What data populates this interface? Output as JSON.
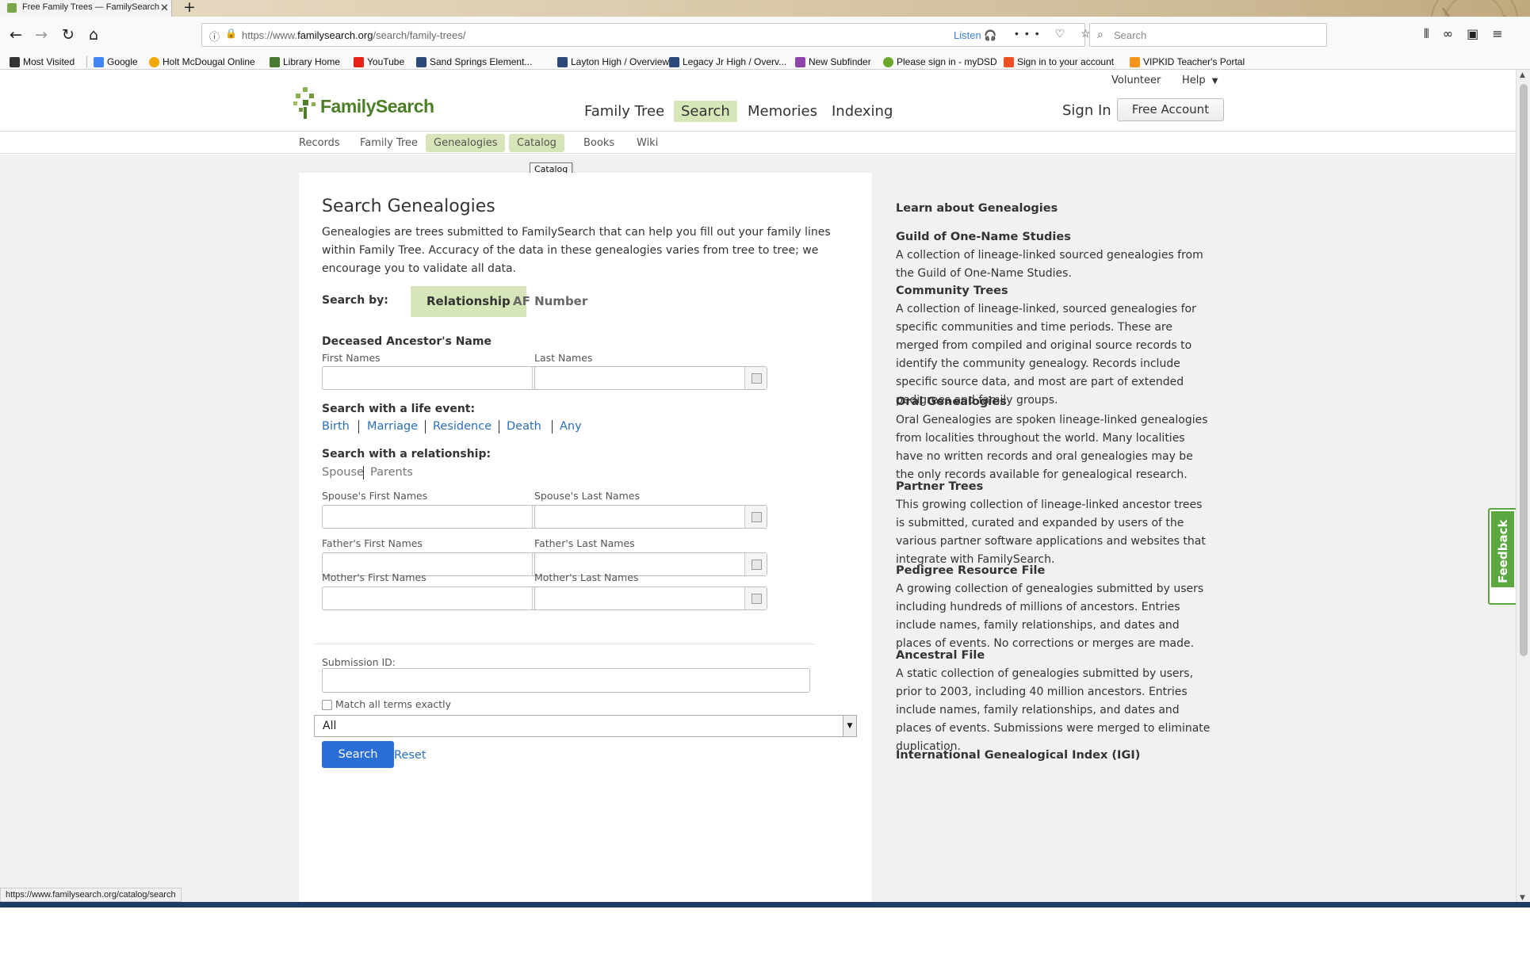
{
  "browser": {
    "tab_title": "Free Family Trees — FamilySearch",
    "url_path_pre": "https://www.",
    "url_domain": "familysearch.org",
    "url_path": "/search/family-trees/",
    "listen_label": "Listen",
    "search_placeholder": "Search",
    "bookmarks": [
      {
        "label": "Most Visited",
        "icon": "gear-icon",
        "color": "#333333"
      },
      {
        "label": "Google",
        "icon": "google-icon",
        "color": "#4285f4"
      },
      {
        "label": "Holt McDougal Online",
        "icon": "holt-icon",
        "color": "#f0a800"
      },
      {
        "label": "Library Home",
        "icon": "library-icon",
        "color": "#4a7a32"
      },
      {
        "label": "YouTube",
        "icon": "youtube-icon",
        "color": "#e62117"
      },
      {
        "label": "Sand Springs Element...",
        "icon": "school-icon",
        "color": "#2b4a7a"
      },
      {
        "label": "Layton High / Overview",
        "icon": "school-icon",
        "color": "#2b4a7a"
      },
      {
        "label": "Legacy Jr High / Overv...",
        "icon": "school-icon",
        "color": "#2b4a7a"
      },
      {
        "label": "New Subfinder",
        "icon": "subfinder-icon",
        "color": "#8e44ad"
      },
      {
        "label": "Please sign in - myDSD",
        "icon": "leaf-icon",
        "color": "#6aa82c"
      },
      {
        "label": "Sign in to your account",
        "icon": "microsoft-icon",
        "color": "#f25022"
      },
      {
        "label": "VIPKID Teacher's Portal",
        "icon": "vipkid-icon",
        "color": "#f7941d"
      }
    ],
    "status_url": "https://www.familysearch.org/catalog/search"
  },
  "header": {
    "logo_text": "FamilySearch",
    "utility": {
      "volunteer": "Volunteer",
      "help": "Help"
    },
    "main_nav": [
      {
        "label": "Family Tree",
        "active": false
      },
      {
        "label": "Search",
        "active": true
      },
      {
        "label": "Memories",
        "active": false
      },
      {
        "label": "Indexing",
        "active": false
      }
    ],
    "sign_in": "Sign In",
    "free_account": "Free Account",
    "sub_nav": [
      {
        "label": "Records",
        "active": false
      },
      {
        "label": "Family Tree",
        "active": false
      },
      {
        "label": "Genealogies",
        "active": true
      },
      {
        "label": "Catalog",
        "active": true
      },
      {
        "label": "Books",
        "active": false
      },
      {
        "label": "Wiki",
        "active": false
      }
    ],
    "tooltip": "Catalog"
  },
  "search": {
    "title": "Search Genealogies",
    "intro": "Genealogies are trees submitted to FamilySearch that can help you fill out your family lines within Family Tree. Accuracy of the data in these genealogies varies from tree to tree; we encourage you to validate all data.",
    "search_by_label": "Search by:",
    "search_by_options": [
      "Relationship",
      "AF Number"
    ],
    "ancestor_heading": "Deceased Ancestor's Name",
    "first_names": "First Names",
    "last_names": "Last Names",
    "life_event_heading": "Search with a life event:",
    "life_events": [
      "Birth",
      "Marriage",
      "Residence",
      "Death",
      "Any"
    ],
    "relationship_heading": "Search with a relationship:",
    "relationships": [
      "Spouse",
      "Parents"
    ],
    "spouse_first": "Spouse's First Names",
    "spouse_last": "Spouse's Last Names",
    "father_first": "Father's First Names",
    "father_last": "Father's Last Names",
    "mother_first": "Mother's First Names",
    "mother_last": "Mother's Last Names",
    "submission_id": "Submission ID:",
    "match_exact": "Match all terms exactly",
    "collection_selected": "All",
    "search_button": "Search",
    "reset": "Reset"
  },
  "sidebar": {
    "heading": "Learn about Genealogies",
    "sections": [
      {
        "title": "Guild of One-Name Studies",
        "body": "A collection of lineage-linked sourced genealogies from the Guild of One-Name Studies."
      },
      {
        "title": "Community Trees",
        "body": "A collection of lineage-linked, sourced genealogies for specific communities and time periods. These are merged from compiled and original source records to identify the community genealogy. Records include specific source data, and most are part of extended pedigrees and family groups."
      },
      {
        "title": "Oral Genealogies",
        "body": "Oral Genealogies are spoken lineage-linked genealogies from localities throughout the world. Many localities have no written records and oral genealogies may be the only records available for genealogical research."
      },
      {
        "title": "Partner Trees",
        "body": "This growing collection of lineage-linked ancestor trees is submitted, curated and expanded by users of the various partner software applications and websites that integrate with FamilySearch."
      },
      {
        "title": "Pedigree Resource File",
        "body": "A growing collection of genealogies submitted by users including hundreds of millions of ancestors. Entries include names, family relationships, and dates and places of events. No corrections or merges are made."
      },
      {
        "title": "Ancestral File",
        "body": "A static collection of genealogies submitted by users, prior to 2003, including 40 million ancestors. Entries include names, family relationships, and dates and places of events. Submissions were merged to eliminate duplication."
      },
      {
        "title": "International Genealogical Index (IGI)",
        "body": ""
      }
    ]
  },
  "feedback_label": "Feedback",
  "colors": {
    "accent_green": "#d6e6b8",
    "brand_green": "#4c7e27",
    "link_blue": "#2a6ebb",
    "button_blue": "#2a6ed6"
  }
}
